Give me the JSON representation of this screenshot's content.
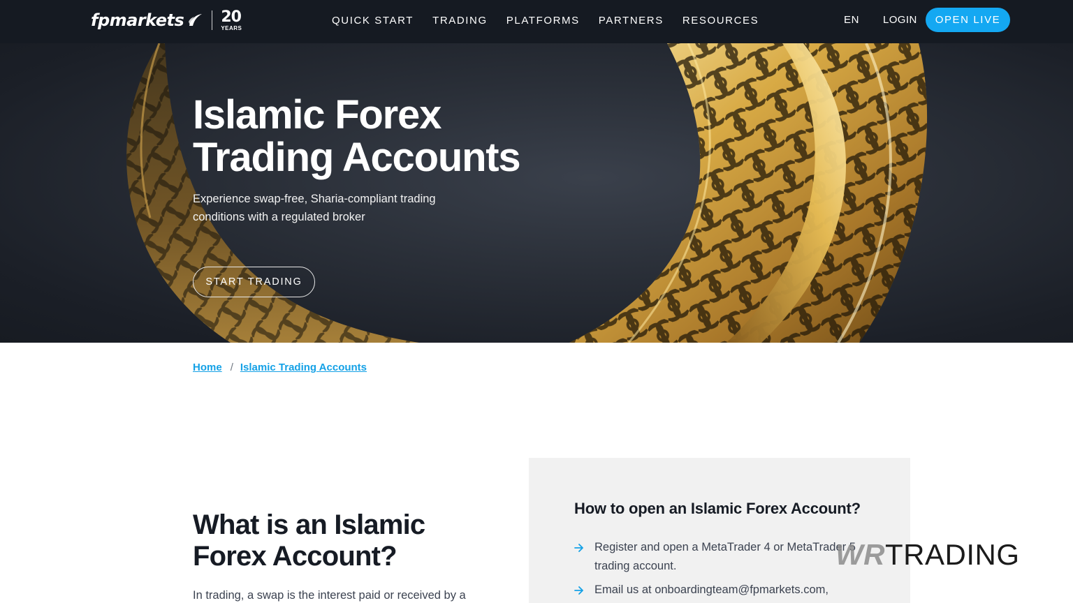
{
  "header": {
    "logo_text": "fpmarkets",
    "logo_years_number": "20",
    "logo_years_label": "YEARS",
    "nav": [
      {
        "label": "QUICK START"
      },
      {
        "label": "TRADING"
      },
      {
        "label": "PLATFORMS"
      },
      {
        "label": "PARTNERS"
      },
      {
        "label": "RESOURCES"
      }
    ],
    "language": "EN",
    "login_label": "LOGIN",
    "open_live_label": "OPEN LIVE"
  },
  "hero": {
    "title_line1": "Islamic Forex",
    "title_line2": "Trading Accounts",
    "subtitle_line1": "Experience swap-free, Sharia-compliant trading",
    "subtitle_line2": "conditions with a regulated broker",
    "cta_label": "START TRADING",
    "image_subject": "golden crescent moon"
  },
  "breadcrumb": {
    "items": [
      {
        "label": "Home"
      },
      {
        "label": "Islamic Trading Accounts"
      }
    ],
    "separator": "/"
  },
  "intro": {
    "title_line1": "What is an Islamic",
    "title_line2": "Forex Account?",
    "text": "In trading, a swap is the interest paid or received by a"
  },
  "how_to": {
    "title": "How to open an Islamic Forex Account?",
    "steps": [
      {
        "line1": "Register and open a MetaTrader 4 or MetaTrader 5",
        "line2": "trading account."
      },
      {
        "line1": "Email us at onboardingteam@fpmarkets.com,",
        "line2": ""
      }
    ]
  },
  "watermark": {
    "part1": "WR",
    "part2": "TRADING"
  },
  "colors": {
    "header_bg": "#151a22",
    "accent": "#14a8f2",
    "link": "#14a1e6",
    "gold": "#d4a93c",
    "card_bg": "#f1f1f1"
  }
}
